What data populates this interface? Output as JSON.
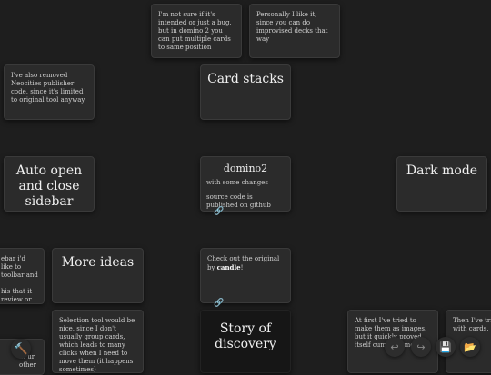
{
  "cards": {
    "not_sure": "I'm not sure if it's intended or just a bug, but in domino 2 you can put multiple cards to same position",
    "personally": "Personally I like it, since you can do improvised decks that way",
    "removed_neocities": "I've also removed Neocities publisher code, since it's limited to original tool anyway",
    "card_stacks": "Card stacks",
    "auto_open": "Auto open and close sidebar",
    "domino2_title": "domino2",
    "domino2_changes": "with some changes",
    "domino2_source": "source code is published on github",
    "dark_mode": "Dark mode",
    "left_partial": "ebar i'd like to toolbar and\n\nhis that it review or put field",
    "more_ideas": "More ideas",
    "check_original_prefix": "Check out the original by",
    "check_original_name": "candle",
    "check_original_suffix": "!",
    "selection_tool": "Selection tool would be nice, since I don't usually group cards, which leads to many clicks when I need to move them (it happens sometimes)",
    "story": "Story of discovery",
    "first_tried": "At first I've tried to make them as images, but it quickly proved itself cumbersome",
    "then_tried": "Then I've tried Simulator with cards, and it w",
    "bottom_left_partial": "ake at ur other"
  },
  "icons": {
    "link": "link-icon",
    "hammer": "hammer-icon",
    "undo": "undo-icon",
    "redo": "redo-icon",
    "save": "save-icon",
    "folder": "folder-open-icon"
  }
}
